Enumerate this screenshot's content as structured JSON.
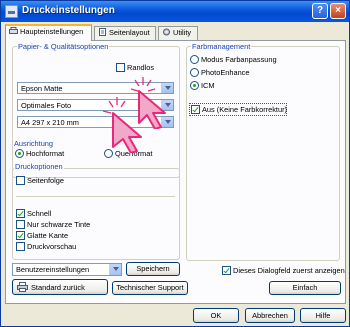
{
  "window": {
    "title": "Druckeinstellungen",
    "help_glyph": "?",
    "close_glyph": "×"
  },
  "tabs": [
    {
      "label": "Haupteinstellungen"
    },
    {
      "label": "Seitenlayout"
    },
    {
      "label": "Utility"
    }
  ],
  "paper": {
    "group_label": "Papier- & Qualitätsoptionen",
    "borderless_label": "Randlos",
    "media_type": "Epson Matte",
    "quality": "Optimales Foto",
    "size": "A4 297 x 210 mm"
  },
  "orientation": {
    "group_label": "Ausrichtung",
    "portrait": "Hochformat",
    "landscape": "Querformat"
  },
  "print_options": {
    "group_label": "Druckoptionen",
    "reverse_order": "Seitenfolge",
    "fast": "Schnell",
    "black_only": "Nur schwarze Tinte",
    "smooth_edges": "Glatte Kante",
    "preview": "Druckvorschau"
  },
  "color_management": {
    "group_label": "Farbmanagement",
    "mode_color_adjust": "Modus Farbanpassung",
    "mode_photo_enhance": "PhotoEnhance",
    "mode_icm": "ICM",
    "off_no_correction": "Aus (Keine Farbkorrektur)"
  },
  "bottom": {
    "user_settings": "Benutzereinstellungen",
    "save": "Speichern",
    "default": "Standard zurück",
    "tech_support": "Technischer Support",
    "always_show": "Dieses Dialogfeld zuerst anzeigen",
    "simple": "Einfach"
  },
  "footer": {
    "ok": "OK",
    "cancel": "Abbrechen",
    "help": "Hilfe"
  },
  "colors": {
    "title_bar": "#0a5bdc",
    "group_label": "#1c3fb0",
    "check_mark": "#21a121",
    "cursor_burst": "#e8287a"
  }
}
